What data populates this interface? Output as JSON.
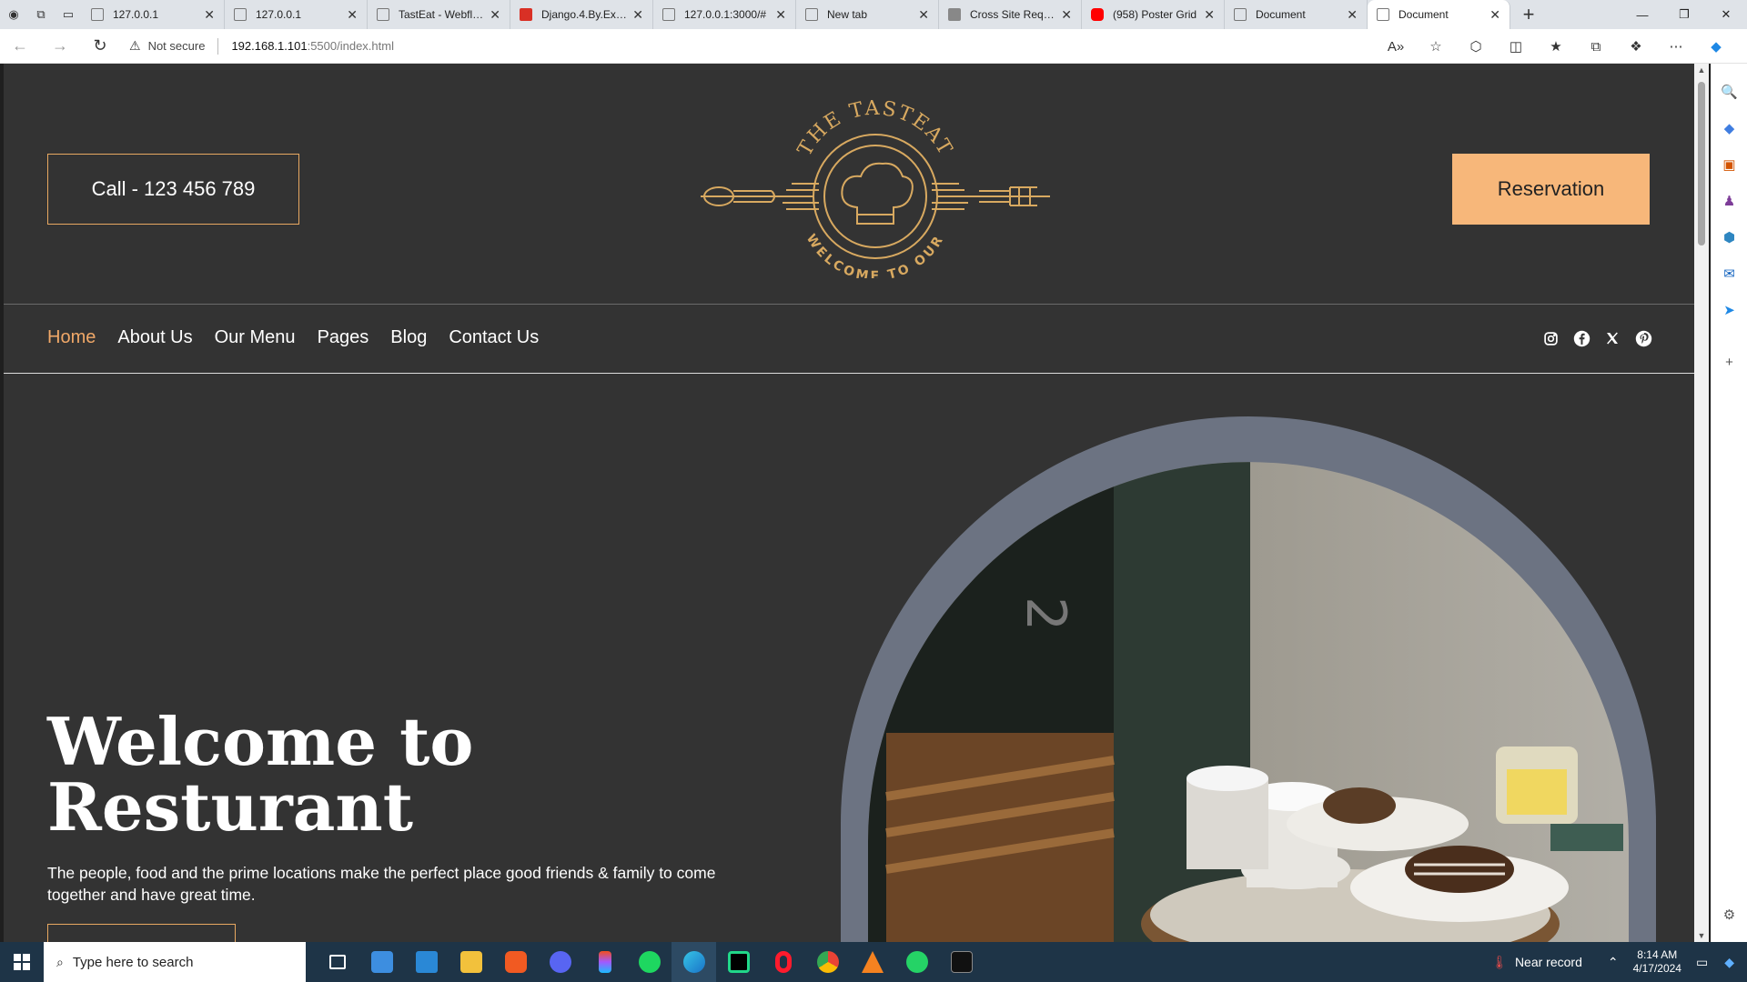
{
  "browser": {
    "tabs": [
      {
        "title": "127.0.0.1",
        "favicon": "page-icon"
      },
      {
        "title": "127.0.0.1",
        "favicon": "page-icon"
      },
      {
        "title": "TastEat - Webflow",
        "favicon": "page-icon"
      },
      {
        "title": "Django.4.By.Exam",
        "favicon": "pdf-icon"
      },
      {
        "title": "127.0.0.1:3000/#",
        "favicon": "page-icon"
      },
      {
        "title": "New tab",
        "favicon": "newtab-icon"
      },
      {
        "title": "Cross Site Reques",
        "favicon": "django-icon"
      },
      {
        "title": "(958) Poster Grid",
        "favicon": "youtube-icon"
      },
      {
        "title": "Document",
        "favicon": "page-icon"
      },
      {
        "title": "Document",
        "favicon": "page-icon"
      }
    ],
    "active_tab": 9,
    "address": {
      "security": "Not secure",
      "host": "192.168.1.101",
      "path": ":5500/index.html"
    }
  },
  "site": {
    "call_label": "Call - 123 456 789",
    "reservation_label": "Reservation",
    "logo": {
      "top_text": "THE TASTEAT",
      "bottom_text": "WELCOME TO OUR"
    },
    "nav": [
      {
        "label": "Home",
        "active": true
      },
      {
        "label": "About Us",
        "active": false
      },
      {
        "label": "Our Menu",
        "active": false
      },
      {
        "label": "Pages",
        "active": false
      },
      {
        "label": "Blog",
        "active": false
      },
      {
        "label": "Contact Us",
        "active": false
      }
    ],
    "social": [
      "instagram-icon",
      "facebook-icon",
      "x-icon",
      "pinterest-icon"
    ],
    "hero": {
      "title_line1": "Welcome to",
      "title_line2": "Resturant",
      "description": "The people, food and the prime locations make the perfect place good friends & family to come together and have great time."
    },
    "colors": {
      "background": "#333333",
      "accent": "#f7b77a",
      "border": "#e8a861",
      "arch": "#6c7382"
    }
  },
  "taskbar": {
    "search_placeholder": "Type here to search",
    "weather": "Near record",
    "time": "8:14 AM",
    "date": "4/17/2024"
  }
}
